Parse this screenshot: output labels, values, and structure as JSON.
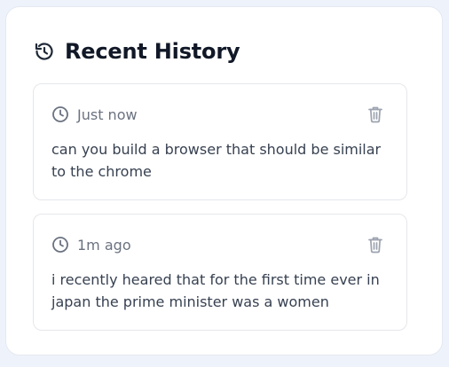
{
  "panel": {
    "title": "Recent History",
    "title_icon": "history-icon"
  },
  "items": [
    {
      "timestamp": "Just now",
      "text": "can you build a browser that should be similar to the chrome",
      "meta_icon": "clock-icon",
      "action_icon": "trash-icon"
    },
    {
      "timestamp": "1m ago",
      "text": "i recently heared that for the first time ever in japan the prime minister was a women",
      "meta_icon": "clock-icon",
      "action_icon": "trash-icon"
    }
  ],
  "colors": {
    "background": "#eef3fb",
    "panel": "#ffffff",
    "title": "#111827",
    "muted": "#6b7280",
    "body_text": "#374151",
    "border": "#e5e7eb",
    "icon": "#9ca3af"
  }
}
